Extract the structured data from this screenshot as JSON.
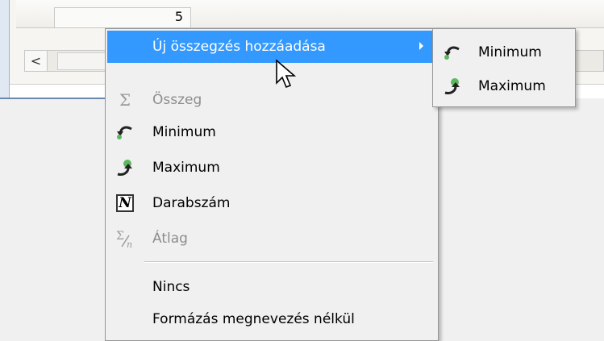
{
  "background": {
    "cell_value": "5",
    "scroll_left_glyph": "<"
  },
  "menu": {
    "items": [
      {
        "label": "Új összegzés hozzáadása",
        "icon": "none",
        "state": "highlighted",
        "submenu": true
      },
      {
        "label": "Összeg",
        "icon": "sigma-icon",
        "state": "disabled"
      },
      {
        "label": "Minimum",
        "icon": "minimum-icon",
        "state": "enabled"
      },
      {
        "label": "Maximum",
        "icon": "maximum-icon",
        "state": "enabled"
      },
      {
        "label": "Darabszám",
        "icon": "count-icon",
        "icon_glyph": "N",
        "state": "enabled"
      },
      {
        "label": "Átlag",
        "icon": "average-icon",
        "state": "disabled"
      },
      {
        "label": "Nincs",
        "icon": "none",
        "state": "enabled"
      },
      {
        "label": "Formázás megnevezés nélkül",
        "icon": "none",
        "state": "enabled"
      }
    ]
  },
  "submenu": {
    "items": [
      {
        "label": "Minimum",
        "icon": "minimum-icon"
      },
      {
        "label": "Maximum",
        "icon": "maximum-icon"
      }
    ]
  },
  "colors": {
    "highlight": "#3399ff",
    "disabled_text": "#8d8d8d",
    "menu_bg": "#f0f0f0"
  }
}
